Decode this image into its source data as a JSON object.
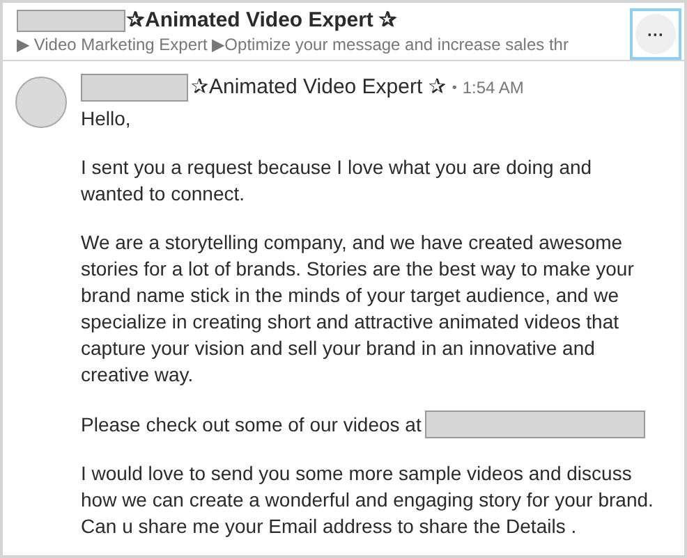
{
  "conversation": {
    "title": "✰Animated Video Expert ✰",
    "subtitle": "▶ Video Marketing Expert ▶Optimize your message and increase sales thr",
    "more_button": "···"
  },
  "message": {
    "sender": "✰Animated Video Expert ✰",
    "separator": "•",
    "time": "1:54 AM",
    "paragraphs": [
      {
        "text": "Hello,",
        "link_redacted": false
      },
      {
        "text": "I sent you a request because I love what you are doing and wanted to connect.",
        "link_redacted": false
      },
      {
        "text": "We are a storytelling company, and we have created awesome stories for a lot of brands. Stories are the best way to make your brand name stick in the minds of your target audience, and we specialize in creating short and attractive animated videos that capture your vision and sell your brand in an innovative and creative way.",
        "link_redacted": false
      },
      {
        "text": "Please check out some of our videos at",
        "link_redacted": true
      },
      {
        "text": "I would love to send you some more sample videos and discuss how we can create a wonderful and engaging story for your brand. Can u share me your Email address to share the Details .",
        "link_redacted": false
      }
    ]
  }
}
